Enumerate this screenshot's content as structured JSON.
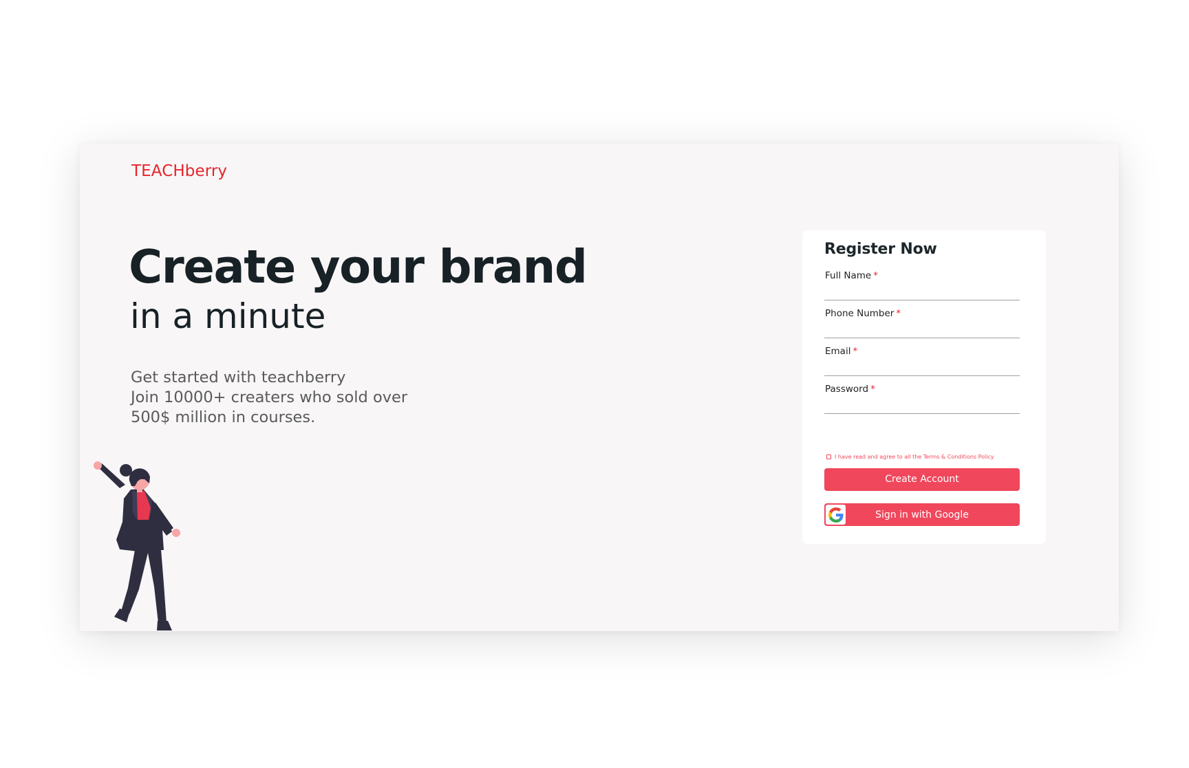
{
  "brand": {
    "logo_text": "TEACHberry",
    "logo_color": "#e8242d"
  },
  "hero": {
    "headline": "Create your brand",
    "subheadline": "in a minute",
    "intro_lines": [
      "Get started with teachberry",
      "Join 10000+  creaters who sold over",
      "500$ million in courses."
    ],
    "illustration_icon": "woman-waving-illustration"
  },
  "register": {
    "title": "Register Now",
    "required_marker": "*",
    "fields": [
      {
        "label": "Full Name",
        "value": "",
        "required": true
      },
      {
        "label": "Phone Number",
        "value": "",
        "required": true
      },
      {
        "label": "Email",
        "value": "",
        "required": true
      },
      {
        "label": "Password",
        "value": "",
        "required": true
      }
    ],
    "agree_text": "I have read and agree to all the Terms & Conditions Policy",
    "agree_checked": false,
    "create_button_label": "Create Account",
    "google_button_label": "Sign in with Google",
    "google_icon": "google-g-icon"
  },
  "colors": {
    "accent": "#f0475c",
    "heading": "#172126",
    "body_text": "#5a5a5a",
    "background": "#f8f6f6",
    "card": "#ffffff"
  }
}
